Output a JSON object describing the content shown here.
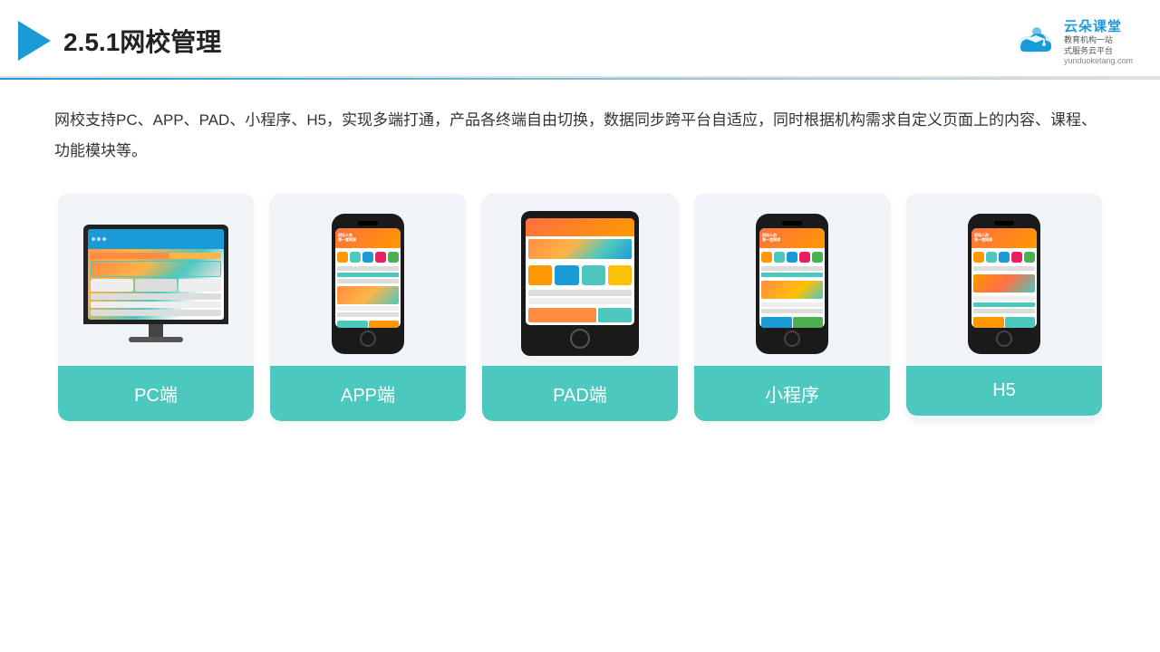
{
  "header": {
    "title": "2.5.1网校管理",
    "brand": {
      "name": "云朵课堂",
      "sub1": "教育机构一站",
      "sub2": "式服务云平台",
      "url": "yunduoketang.com"
    }
  },
  "description": "网校支持PC、APP、PAD、小程序、H5，实现多端打通，产品各终端自由切换，数据同步跨平台自适应，同时根据机构需求自定义页面上的内容、课程、功能模块等。",
  "cards": [
    {
      "id": "pc",
      "label": "PC端"
    },
    {
      "id": "app",
      "label": "APP端"
    },
    {
      "id": "pad",
      "label": "PAD端"
    },
    {
      "id": "miniprogram",
      "label": "小程序"
    },
    {
      "id": "h5",
      "label": "H5"
    }
  ],
  "colors": {
    "accent": "#1a9bd7",
    "teal": "#4dc8be",
    "header_border": "#e0e0e0"
  }
}
